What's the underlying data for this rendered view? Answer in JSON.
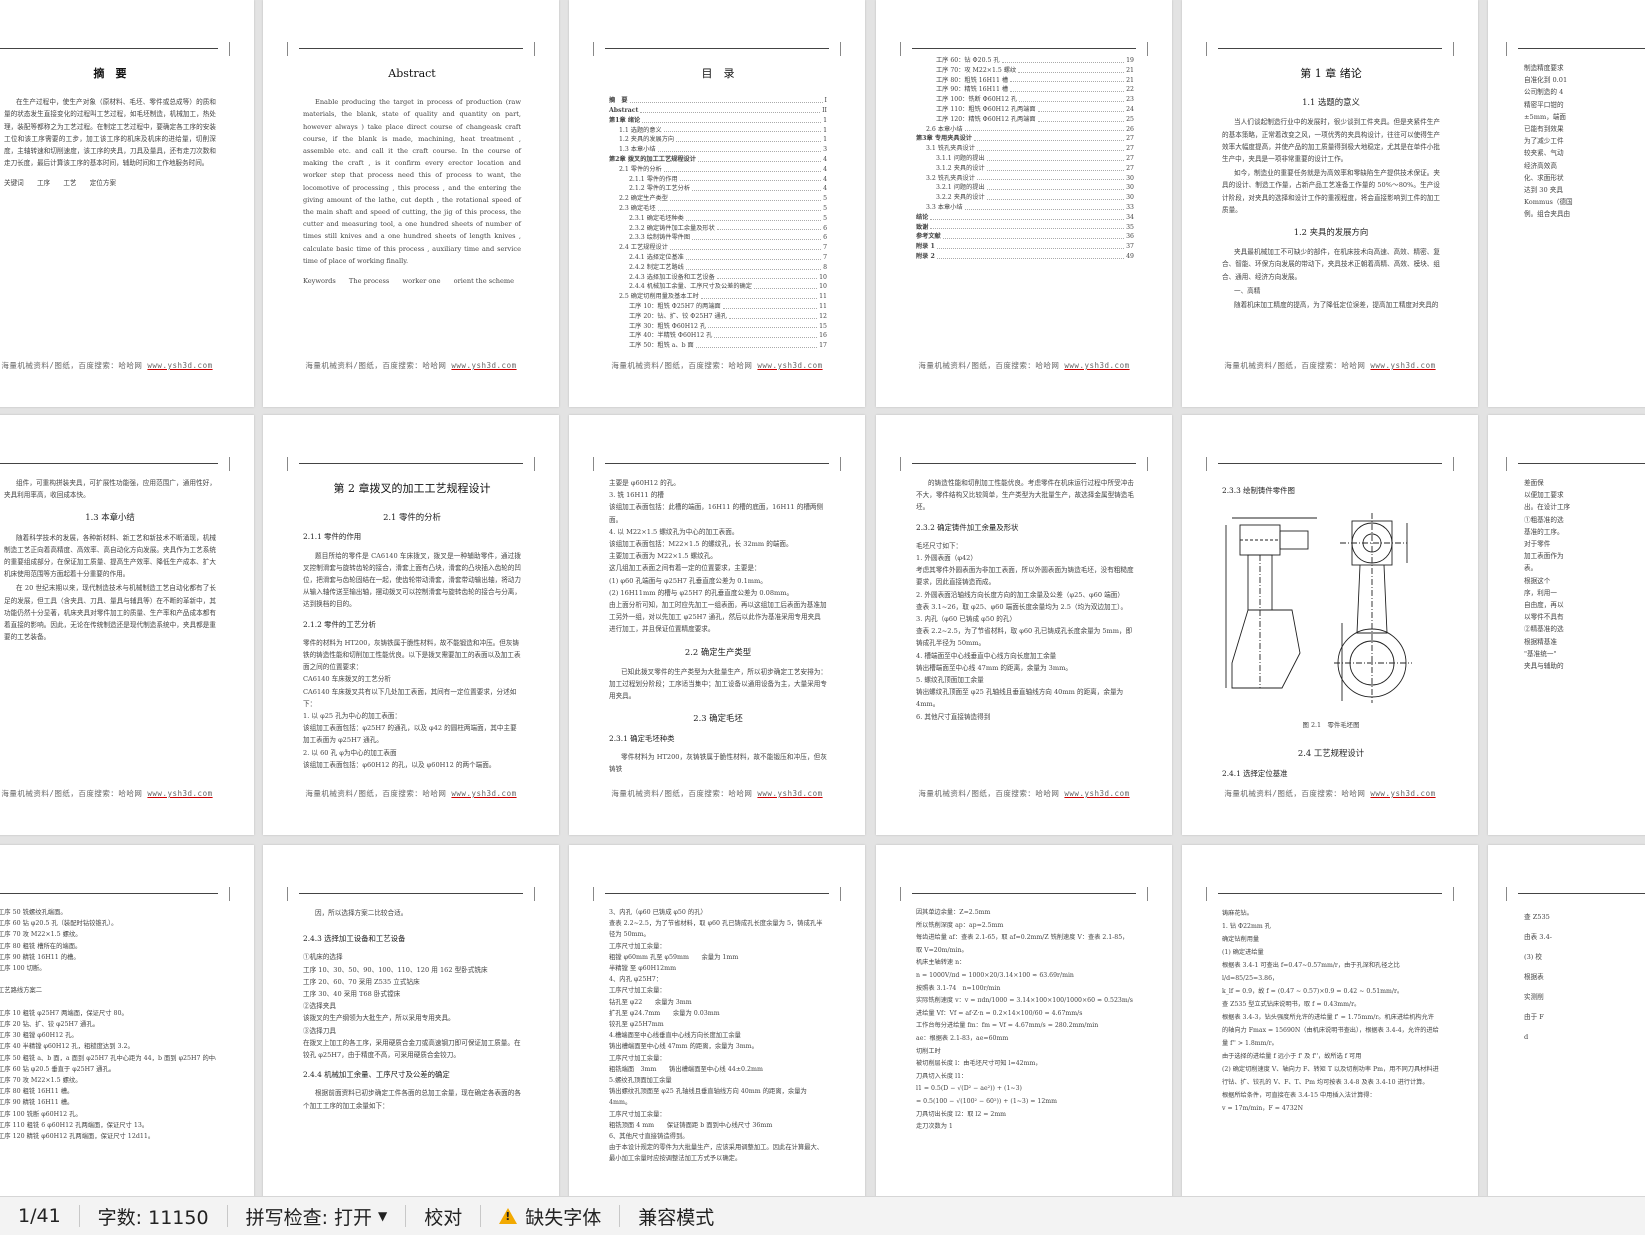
{
  "footer_text": "海量机械资料/图纸，百度搜索：哈哈网 ",
  "footer_link": "www.ysh3d.com",
  "pages": {
    "p1": {
      "title": "摘　要",
      "body": [
        "在生产过程中，使生产对象（原材料、毛坯、零件或总成等）的质和量的状态发生直接变化的过程叫工艺过程，如毛坯制造，机械加工，热处理，装配等都称之为工艺过程。在制定工艺过程中，要确定各工序的安装工位和该工序需要的工步，加工该工序的机床及机床的进给量，切削深度，主轴转速和切削速度，该工序的夹具，刀具及量具，还有走刀次数和走刀长度，最后计算该工序的基本时间，辅助时间和工作地服务时间。"
      ],
      "keywords": "关键词　　工序　　工艺　　定位方案"
    },
    "p2": {
      "title": "Abstract",
      "body": "Enable producing the target in process of production (raw materials, the blank, state of quality and quantity on part, however always ) take place direct course of changeask craft course, if the blank is made, machining, heat treatment , assemble etc. and call it the craft course. In the course of making the craft , is it confirm every erector location and worker step that process need this of process to want, the locomotive of processing , this process , and the entering the giving amount of the lathe, cut depth , the rotational speed of the main shaft and speed of cutting, the jig of this process, the cutter and measuring  tool, a one hundred sheets of number of times  still knives and a one hundred sheets of length knives , calculate basic time of this process , auxiliary time and service time of place of working finally.",
      "keywords": "Keywords　　The process　　worker one　　orient the scheme"
    },
    "p3": {
      "title": "目　录",
      "toc": [
        {
          "t": "摘　要",
          "n": "I",
          "lv": 1
        },
        {
          "t": "Abstract",
          "n": "II",
          "lv": 1
        },
        {
          "t": "第1章  绪论",
          "n": "1",
          "lv": 1
        },
        {
          "t": "1.1 选题的意义",
          "n": "1",
          "lv": 2
        },
        {
          "t": "1.2 夹具的发展方向",
          "n": "1",
          "lv": 2
        },
        {
          "t": "1.3 本章小结",
          "n": "3",
          "lv": 2
        },
        {
          "t": "第2章  拨叉的加工工艺规程设计",
          "n": "4",
          "lv": 1
        },
        {
          "t": "2.1 零件的分析",
          "n": "4",
          "lv": 2
        },
        {
          "t": "2.1.1 零件的作用",
          "n": "4",
          "lv": 3
        },
        {
          "t": "2.1.2 零件的工艺分析",
          "n": "4",
          "lv": 3
        },
        {
          "t": "2.2 确定生产类型",
          "n": "5",
          "lv": 2
        },
        {
          "t": "2.3 确定毛坯",
          "n": "5",
          "lv": 2
        },
        {
          "t": "2.3.1 确定毛坯种类",
          "n": "5",
          "lv": 3
        },
        {
          "t": "2.3.2 确定铸件加工余量及形状",
          "n": "6",
          "lv": 3
        },
        {
          "t": "2.3.3 绘制铸件零件图",
          "n": "6",
          "lv": 3
        },
        {
          "t": "2.4 工艺规程设计",
          "n": "7",
          "lv": 2
        },
        {
          "t": "2.4.1 选择定位基准",
          "n": "7",
          "lv": 3
        },
        {
          "t": "2.4.2 制定工艺路线",
          "n": "8",
          "lv": 3
        },
        {
          "t": "2.4.3 选择加工设备和工艺设备",
          "n": "10",
          "lv": 3
        },
        {
          "t": "2.4.4 机械加工余量、工序尺寸及公差的确定",
          "n": "10",
          "lv": 3
        },
        {
          "t": "2.5 确定切削用量及基本工时",
          "n": "11",
          "lv": 2
        },
        {
          "t": "工序 10：粗铣 Φ25H7 的两端面",
          "n": "11",
          "lv": 3
        },
        {
          "t": "工序 20：钻、扩、铰 Φ25H7 通孔",
          "n": "12",
          "lv": 3
        },
        {
          "t": "工序 30：粗铣 Φ60H12 孔",
          "n": "15",
          "lv": 3
        },
        {
          "t": "工序 40：半精铣 Φ60H12 孔",
          "n": "16",
          "lv": 3
        },
        {
          "t": "工序 50：粗铣 a、b 面",
          "n": "17",
          "lv": 3
        }
      ]
    },
    "p4": {
      "toc": [
        {
          "t": "工序 60：钻 Φ20.5 孔",
          "n": "19",
          "lv": 3
        },
        {
          "t": "工序 70：攻 M22×1.5 螺纹",
          "n": "21",
          "lv": 3
        },
        {
          "t": "工序 80：粗铣 16H11 槽",
          "n": "21",
          "lv": 3
        },
        {
          "t": "工序 90：精铣 16H11 槽",
          "n": "22",
          "lv": 3
        },
        {
          "t": "工序 100：铣断 Φ60H12 孔",
          "n": "23",
          "lv": 3
        },
        {
          "t": "工序 110：粗铣 Φ60H12 孔两端面",
          "n": "24",
          "lv": 3
        },
        {
          "t": "工序 120：精铣 Φ60H12 孔两端面",
          "n": "25",
          "lv": 3
        },
        {
          "t": "2.6 本章小结",
          "n": "26",
          "lv": 2
        },
        {
          "t": "第3章  专用夹具设计",
          "n": "27",
          "lv": 1
        },
        {
          "t": "3.1 铣孔夹具设计",
          "n": "27",
          "lv": 2
        },
        {
          "t": "3.1.1 问题的提出",
          "n": "27",
          "lv": 3
        },
        {
          "t": "3.1.2 夹具的设计",
          "n": "27",
          "lv": 3
        },
        {
          "t": "3.2 铣孔夹具设计",
          "n": "30",
          "lv": 2
        },
        {
          "t": "3.2.1 问题的提出",
          "n": "30",
          "lv": 3
        },
        {
          "t": "3.2.2 夹具的设计",
          "n": "30",
          "lv": 3
        },
        {
          "t": "3.3 本章小结",
          "n": "33",
          "lv": 2
        },
        {
          "t": "结论",
          "n": "34",
          "lv": 1
        },
        {
          "t": "致谢",
          "n": "35",
          "lv": 1
        },
        {
          "t": "参考文献",
          "n": "36",
          "lv": 1
        },
        {
          "t": "附录 1",
          "n": "37",
          "lv": 1
        },
        {
          "t": "附录 2",
          "n": "49",
          "lv": 1
        }
      ]
    },
    "p5": {
      "title": "第 1 章  绪论",
      "h_a": "1.1  选题的意义",
      "body_a": [
        "当人们谈起制造行业中的发展时，很少谈到工件夹具。但是夹紧件生产的基本策略，正常着改变之风，一项优秀的夹具构设计，往往可以使得生产效率大幅度提高，并使产品的加工质量得到极大地稳定，尤其是在单件小批生产中，夹具是一项非常重要的设计工作。",
        "如今，制造业的重要任务就是为高效率和零缺陷生产提供技术保证。夹具的设计、制造工作量，占新产品工艺准备工作量的 50%～80%。生产设计阶段，对夹具的选择和设计工作的重视程度，将会直接影响到工件的加工质量。"
      ],
      "h_b": "1.2  夹具的发展方向",
      "body_b": [
        "夹具最机械加工不可缺少的部件，在机床技术向高速、高效、精密、复合、智能、环保方向发展的带动下，夹具技术正朝着高精、高效、模块、组合、通用、经济方向发展。",
        "一、高精",
        "随着机床加工精度的提高，为了降低定位误差，提高加工精度对夹具的"
      ]
    },
    "p7": {
      "body_a": [
        "组件，可重构拼装夹具，可扩展性功能强，应用范围广，通用性好，夹具利用率高，收回成本快。"
      ],
      "h": "1.3  本章小结",
      "body_b": [
        "随着科学技术的发展，各种新材料、新工艺和新技术不断涌现，机械制造工艺正向着高精度、高效率、高自动化方向发展。夹具作为工艺系统的重要组成部分，在保证加工质量、提高生产效率、降低生产成本、扩大机床使用范围等方面起着十分重要的作用。",
        "在 20 世纪末期以来，现代制造技术与机械制造工艺自动化都有了长足的发展，但工具（含夹具、刀具、量具与辅具等）在不断的革新中，其功能仍然十分显著，机床夹具对零件加工的质量、生产率和产品成本都有着直接的影响。因此，无论在传统制造还是现代制造系统中，夹具都是重要的工艺装备。"
      ]
    },
    "p8": {
      "title": "第 2 章拨叉的加工工艺规程设计",
      "h_a": "2.1  零件的分析",
      "h3_a": "2.1.1 零件的作用",
      "body_a": [
        "题目所给的零件是 CA6140 车床拨叉，拨叉是一种辅助零件，通过拨叉控制滑套与旋转齿轮的接合，滑套上面有凸块，滑套的凸块插入齿轮的凹位，把滑套与齿轮固结在一起，使齿轮带动滑套，滑套带动输出轴，将动力从输入轴传送至输出轴，摆动拨叉可以控制滑套与旋转齿轮的接合与分离，达到换档的目的。"
      ],
      "h3_b": "2.1.2 零件的工艺分析",
      "body_b": [
        "零件的材料为 HT200，灰铸铁属于脆性材料，故不能锻造和冲压。但灰铸铁的铸造性能和切削加工性能优良。以下是拨叉需要加工的表面以及加工表面之间的位置要求：",
        "CA6140 车床拨叉的工艺分析",
        "CA6140 车床拨叉共有以下几处加工表面，其间有一定位置要求，分述如下：",
        "1. 以 φ25 孔为中心的加工表面：",
        "该组加工表面包括：φ25H7 的通孔，以及 φ42 的圆柱两端面，其中主要加工表面为 φ25H7 通孔。",
        "2. 以 60 孔 φ为中心的加工表面",
        "该组加工表面包括：φ60H12 的孔，以及 φ60H12 的两个端面。"
      ]
    },
    "p9": {
      "body_a": [
        "主要是 φ60H12 的孔。",
        "3. 铣 16H11 的槽",
        "该组加工表面包括：此槽的端面，16H11 的槽的底面，16H11 的槽两侧面。",
        "4. 以 M22×1.5 螺纹孔为中心的加工表面。",
        "该组加工表面包括：M22×1.5 的螺纹孔，长 32mm 的端面。",
        "主要加工表面为 M22×1.5 螺纹孔。",
        "这几组加工表面之间有着一定的位置要求，主要是：",
        "(1) φ60 孔端面与 φ25H7 孔垂直度公差为 0.1mm。",
        "(2) 16H11mm 的槽与 φ25H7 的孔垂直度公差为 0.08mm。",
        "由上面分析可知，加工时应先加工一组表面，再以这组加工后表面为基准加工另外一组，对以先加工 φ25H7 通孔，然后以此作为基准采用专用夹具进行加工，并且保证位置精度要求。"
      ],
      "h_a": "2.2  确定生产类型",
      "body_b": [
        "已知此拨叉零件的生产类型为大批量生产，所以初步确定工艺安排为：加工过程划分阶段；工序适当集中；加工设备以通用设备为主，大量采用专用夹具。"
      ],
      "h_b": "2.3  确定毛坯",
      "h3": "2.3.1 确定毛坯种类",
      "body_c": [
        "零件材料为 HT200，灰铸铁属于脆性材料，故不能锻压和冲压，但灰铸铁"
      ]
    },
    "p10": {
      "body_a": [
        "的铸造性能和切削加工性能优良。考虑零件在机床运行过程中所受冲击不大，零件结构又比较简单，生产类型为大批量生产，故选择金属型铸造毛坯。"
      ],
      "h3": "2.3.2 确定铸件加工余量及形状",
      "body_b": [
        "毛坯尺寸如下：",
        "1. 外圆表面（φ42）",
        "考虑其零件外圆表面为非加工表面，所以外圆表面为铸造毛坯，没有粗糙度要求，因此直接铸造而成。",
        "2. 外圆表面沿轴线方向长度方向的加工余量及公差（φ25、φ60 端面）",
        "查表 3.1~26，取 φ25、φ60 端面长度余量均为 2.5（均为双边加工）。",
        "3. 内孔（φ60 已铸成 φ50 的孔）",
        "查表 2.2~2.5，为了节省材料，取 φ60 孔已铸成孔长度余量为 5mm，即铸成孔半径为 50mm。",
        "4. 槽端面至中心线垂直中心线方向长度加工余量",
        "铸出槽端面至中心线 47mm 的距离，余量为 3mm。",
        "5. 螺纹孔顶面加工余量",
        "铸出螺纹孔顶面至 φ25 孔轴线且垂直轴线方向 40mm 的距离，余量为 4mm。",
        "6. 其他尺寸直接铸造得到"
      ]
    },
    "p11": {
      "h3_a": "2.3.3 绘制铸件零件图",
      "caption": "图 2.1　零件毛坯图",
      "h_a": "2.4 工艺规程设计",
      "h3_b": "2.4.1 选择定位基准"
    },
    "p13": {
      "body": [
        "工序 50  铣螺纹孔端面。",
        "工序 60  钻 φ20.5 孔（装配时钻铰锥孔）。",
        "工序 70  攻 M22×1.5 螺纹。",
        "工序 80  粗铣 槽所在的端面。",
        "工序 90  精铣 16H11 的槽。",
        "工序 100  切断。",
        "",
        "工艺路线方案二",
        "",
        "工序 10  粗铣 φ25H7 两端面，保证尺寸 80。",
        "工序 20  钻、扩、铰 φ25H7 通孔。",
        "工序 30  粗镗 φ60H12 孔。",
        "工序 40  半精镗 φ60H12 孔，粗糙度达到 3.2。",
        "工序 50  粗铣 a、b 面，a 面到 φ25H7 孔中心距为 44，b 面到 φ25H7 的中心距为 36。",
        "工序 60  钻 φ20.5 垂直于 φ25H7 通孔。",
        "工序 70  攻 M22×1.5 螺纹。",
        "工序 80  粗铣 16H11 槽。",
        "工序 90  精铣 16H11 槽。",
        "工序 100  铣断 φ60H12 孔。",
        "工序 110  粗铣 6 φ60H12 孔两端面，保证尺寸 13。",
        "工序 120  精铣 φ60H12 孔两端面，保证尺寸 12d11。"
      ]
    },
    "p14": {
      "body_a": [
        "因，所以选择方案二比较合适。"
      ],
      "h3_a": "2.4.3 选择加工设备和工艺设备",
      "body_b": [
        "①机床的选择",
        "工序 10、30、50、90、100、110、120 用 162 型卧式铣床",
        "工序 20、60、70 采用 Z535 立式钻床",
        "工序 30、40 采用 T68 卧式镗床",
        "②选择夹具",
        "该拨叉的生产纲领为大批生产，所以采用专用夹具。",
        "③选择刀具",
        "在拨叉上加工的各工序，采用硬质合金刀或高速钢刀即可保证加工质量。在铰孔 φ25H7，由于精度不高，可采用硬质合金铰刀。"
      ],
      "h3_b": "2.4.4 机械加工余量、工序尺寸及公差的确定",
      "body_c": [
        "根据前面资料已初步确定工件各面的总加工余量，现在确定各表面的各个加工工序的加工余量如下："
      ]
    },
    "p15": {
      "body": [
        "3、内孔（φ60 已铸成 φ50 的孔）",
        "查表 2.2~2.5，为了节省材料，取 φ60 孔已铸成孔长度余量为 5，铸成孔半径为 50mm。",
        "工序尺寸加工余量：",
        "粗镗  φ60mm 孔至  φ59mm　　余量为 1mm",
        "半精镗 至 φ60H12mm",
        "4、内孔 φ25H7：",
        "工序尺寸加工余量：",
        "钻孔至 φ22　　余量为 3mm",
        "扩孔至 φ24.7mm　　余量为 0.03mm",
        "铰孔至 φ25H7mm",
        "4.槽端面至中心线垂直中心线方向长度加工余量",
        "铸出槽端面至中心线 47mm 的距离，余量为 3mm。",
        "工序尺寸加工余量：",
        "粗铣端面　3mm　　铸出槽端面至中心线 44±0.2mm",
        "5.螺纹孔顶面加工余量",
        "铸出螺纹孔顶面至 φ25 孔轴线且垂直轴线方向 40mm 的距离，余量为 4mm。",
        "工序尺寸加工余量：",
        "粗铣顶面 4 mm　　保证铸面距 b 面到中心线尺寸 36mm",
        "6、其他尺寸直接铸造得到。",
        "由于本设计规定的零件为大批量生产，应该采用调整加工。因此在计算最大、最小加工余量时应按调整法加工方式予以确定。"
      ]
    },
    "p16": {
      "body": [
        "因其单边余量：Z=2.5mm",
        "所以铣削深度 ap：ap=2.5mm",
        "每齿进给量 af：查表 2.1-65，取 af=0.2mm/Z 铣削速度 V：查表 2.1-85，取 V=20m/min。",
        "机床主轴转速 n：",
        "n = 1000V/πd = 1000×20/3.14×100 ≈ 63.69r/min",
        "按照表 3.1-74　n=100r/min",
        "实际铣削速度 v：v = πdn/1000 = 3.14×100×100/1000×60 ≈ 0.523m/s",
        "进给量 Vf：Vf = af·Z·n = 0.2×14×100/60 = 4.67mm/s",
        "工作台每分进给量 fm：fm = Vf = 4.67mm/s = 280.2mm/min",
        "ae：根据表 2.1-83，ae=60mm",
        "切削工时",
        "被切削层长度 l：由毛坯尺寸可知 l=42mm，",
        "刀具切入长度 l1：",
        "l1 = 0.5(D − √(D² − ae²)) + (1~3)",
        "= 0.5(100 − √(100² − 60²)) + (1~3) = 12mm",
        "刀具切出长度 l2：取 l2 = 2mm",
        "走刀次数为 1"
      ]
    },
    "p17": {
      "body": [
        "铸麻花钻。",
        "1. 钻 Φ22mm 孔",
        "确定钻削用量",
        "(1) 确定进给量",
        "根据表 3.4-1 可查出 f=0.47~0.57mm/r，由于孔深和孔径之比 l/d=85/25=3.86，",
        "k_lf = 0.9，故 f = (0.47 ~ 0.57)×0.9 = 0.42 ~ 0.51mm/r。",
        "查 Z535 型立式钻床说明书，取 f = 0.43mm/r。",
        "根据表 3.4-3，钻头强度所允许的进给量 f' = 1.75mm/r。机床进给机构允许的轴向力 Fmax = 15690N（由机床说明书查出），根据表 3.4-4，允许的进给量 f'' > 1.8mm/r。",
        "由于选择的进给量 f 远小于 f' 及 f''，故所选 f 可用",
        "(2) 确定切削速度 V、轴向力 F、转矩 T 以及切削功率 Pm，用不同刀具材料进行钻、扩、铰孔的 V、F、T、Pm 均可按表 3.4-8 及表 3.4-10 进行计算。",
        "根据所给条件，可直接在表 3.4-15 中用插入法计算得：",
        "v = 17m/min，F = 4732N"
      ]
    },
    "p6": {
      "lines": [
        "制造精度要求",
        "自准化到 0.01",
        "公司制造的 4",
        "精密平口钳的",
        "±5mm，端面",
        "已能有到效果",
        "为了减少工件",
        "较夹紧、气动",
        "经济高效高",
        "化、求面形状",
        "达到 30 夹具",
        "Kommus（德国",
        "例。组合夹具由"
      ]
    },
    "p12": {
      "lines": [
        "差面保",
        "以便加工要求",
        "出。在设计工序",
        "①粗基准的选",
        "基准的工序。",
        "对于零件",
        "加工表面作为",
        "表。",
        "根据这个",
        "序，利用一",
        "自由度，再以",
        "以零件不具有",
        "②精基准的选",
        "根据精基准",
        "\"基准统一\"",
        "夹具与辅助的"
      ]
    },
    "p18": {
      "lines": [
        "查 Z535",
        "由表 3.4-",
        "(3) 校",
        "根据表",
        "实测削",
        "由于 F",
        "d"
      ]
    },
    "status": {
      "page": "1/41",
      "words": "字数: 11150",
      "spell": "拼写检查: 打开",
      "proof": "校对",
      "font_warn": "缺失字体",
      "compat": "兼容模式"
    }
  }
}
